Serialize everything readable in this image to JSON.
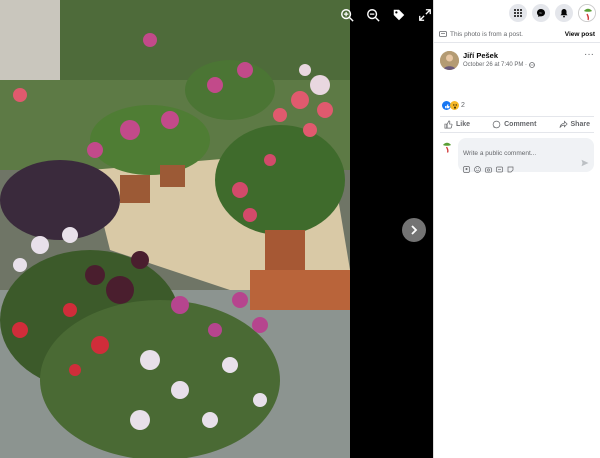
{
  "viewer": {
    "tools": [
      "zoom-in-icon",
      "zoom-out-icon",
      "tag-icon",
      "fullscreen-icon"
    ],
    "next_icon": "chevron-right-icon"
  },
  "topbar": {
    "icons": [
      "menu-grid-icon",
      "messenger-icon",
      "bell-icon"
    ],
    "colors": {
      "button_bg": "#e4e6eb"
    }
  },
  "notice": {
    "text": "This photo is from a post.",
    "link": "View post"
  },
  "post": {
    "author": "Jiří Pešek",
    "timestamp": "October 26 at 7:40 PM ·",
    "privacy_icon": "globe-icon",
    "reaction_count": "2",
    "reactions": [
      "like-icon",
      "wow-icon"
    ]
  },
  "actions": {
    "like": "Like",
    "comment": "Comment",
    "share": "Share"
  },
  "comment": {
    "placeholder": "Write a public comment...",
    "tools": [
      "avatar-sticker-icon",
      "emoji-icon",
      "camera-icon",
      "gif-icon",
      "sticker-icon"
    ]
  },
  "colors": {
    "accent": "#1877f2",
    "muted": "#65676b"
  }
}
